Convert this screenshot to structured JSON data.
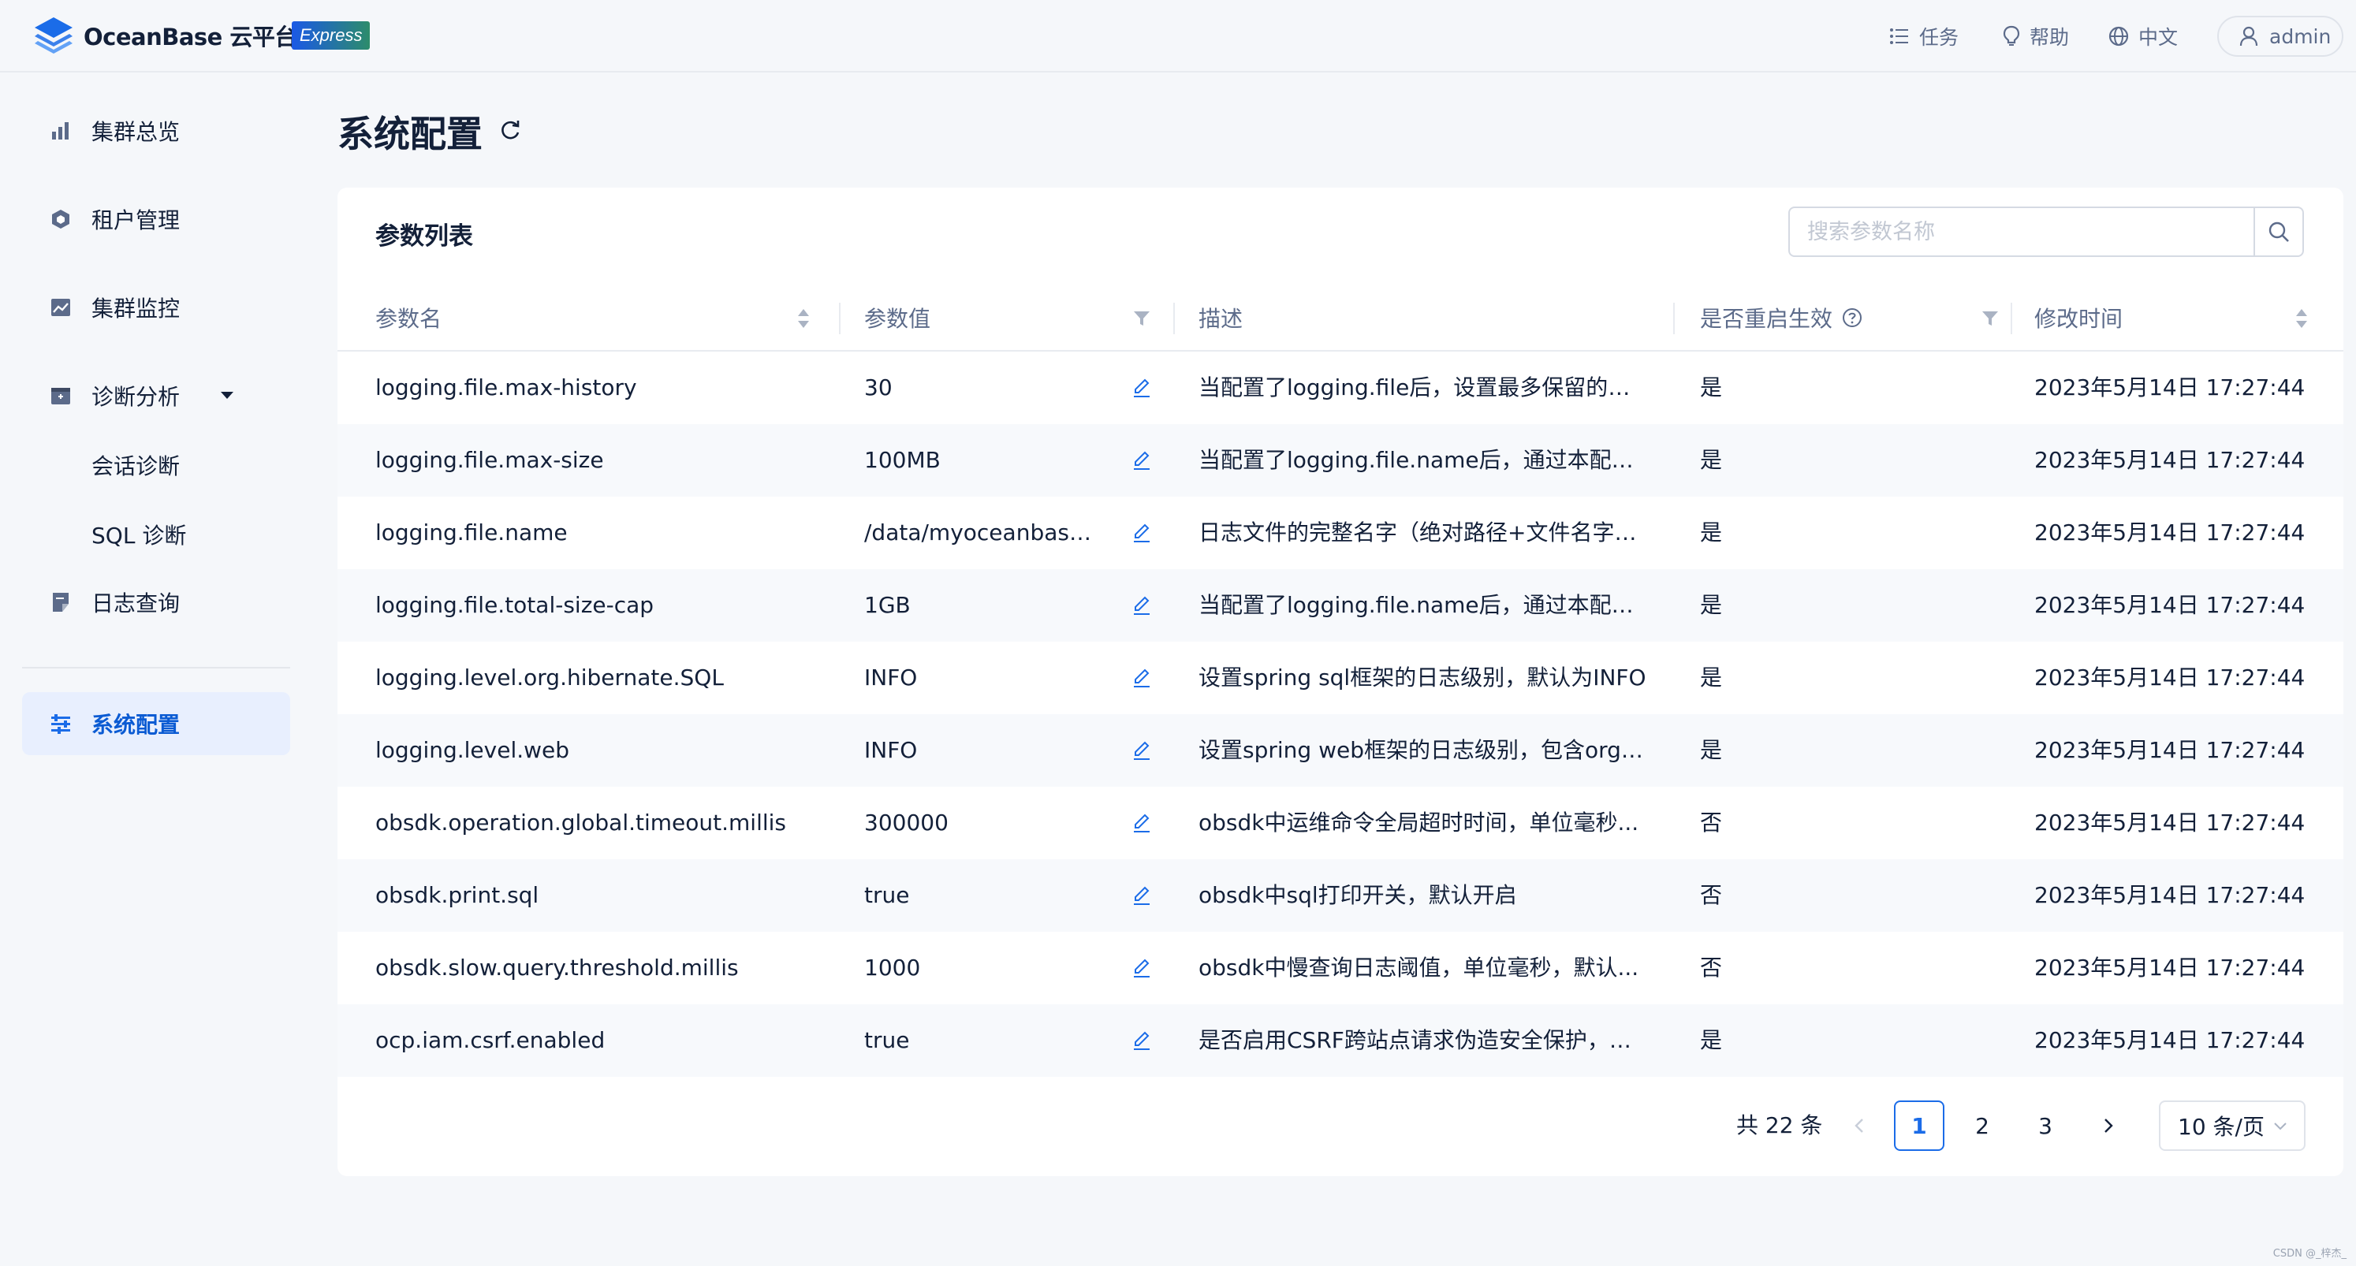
{
  "header": {
    "brand": "OceanBase 云平台",
    "badge": "Express",
    "nav_tasks": "任务",
    "nav_help": "帮助",
    "nav_lang": "中文",
    "user": "admin"
  },
  "sidebar": {
    "items": [
      {
        "label": "集群总览",
        "icon": "bar-chart-icon"
      },
      {
        "label": "租户管理",
        "icon": "tenant-hexagon-icon"
      },
      {
        "label": "集群监控",
        "icon": "monitor-chart-icon"
      },
      {
        "label": "诊断分析",
        "icon": "diagnosis-box-icon"
      },
      {
        "label": "日志查询",
        "icon": "log-file-icon"
      },
      {
        "label": "系统配置",
        "icon": "settings-sliders-icon"
      }
    ],
    "sub_items": [
      "会话诊断",
      "SQL 诊断"
    ]
  },
  "page": {
    "title": "系统配置"
  },
  "card": {
    "title": "参数列表",
    "search_placeholder": "搜索参数名称"
  },
  "table": {
    "columns": {
      "name": "参数名",
      "value": "参数值",
      "desc": "描述",
      "restart": "是否重启生效",
      "time": "修改时间"
    },
    "rows": [
      {
        "name": "logging.file.max-history",
        "value": "30",
        "desc": "当配置了logging.file后，设置最多保留的归...",
        "restart": "是",
        "time": "2023年5月14日 17:27:44"
      },
      {
        "name": "logging.file.max-size",
        "value": "100MB",
        "desc": "当配置了logging.file.name后，通过本配置...",
        "restart": "是",
        "time": "2023年5月14日 17:27:44"
      },
      {
        "name": "logging.file.name",
        "value": "/data/myoceanbase/oc...",
        "desc": "日志文件的完整名字（绝对路径+文件名字）...",
        "restart": "是",
        "time": "2023年5月14日 17:27:44"
      },
      {
        "name": "logging.file.total-size-cap",
        "value": "1GB",
        "desc": "当配置了logging.file.name后，通过本配置...",
        "restart": "是",
        "time": "2023年5月14日 17:27:44"
      },
      {
        "name": "logging.level.org.hibernate.SQL",
        "value": "INFO",
        "desc": "设置spring sql框架的日志级别，默认为INFO",
        "restart": "是",
        "time": "2023年5月14日 17:27:44"
      },
      {
        "name": "logging.level.web",
        "value": "INFO",
        "desc": "设置spring web框架的日志级别，包含org.s...",
        "restart": "是",
        "time": "2023年5月14日 17:27:44"
      },
      {
        "name": "obsdk.operation.global.timeout.millis",
        "value": "300000",
        "desc": "obsdk中运维命令全局超时时间，单位毫秒...",
        "restart": "否",
        "time": "2023年5月14日 17:27:44"
      },
      {
        "name": "obsdk.print.sql",
        "value": "true",
        "desc": "obsdk中sql打印开关，默认开启",
        "restart": "否",
        "time": "2023年5月14日 17:27:44"
      },
      {
        "name": "obsdk.slow.query.threshold.millis",
        "value": "1000",
        "desc": "obsdk中慢查询日志阈值，单位毫秒，默认...",
        "restart": "否",
        "time": "2023年5月14日 17:27:44"
      },
      {
        "name": "ocp.iam.csrf.enabled",
        "value": "true",
        "desc": "是否启用CSRF跨站点请求伪造安全保护，通...",
        "restart": "是",
        "time": "2023年5月14日 17:27:44"
      }
    ]
  },
  "pagination": {
    "total": "共 22 条",
    "pages": [
      "1",
      "2",
      "3"
    ],
    "current": "1",
    "page_size": "10 条/页"
  },
  "watermark": "CSDN @_梓杰_",
  "colors": {
    "accent": "#1b6ce8",
    "sidebar_active_bg": "#e8effe",
    "page_bg": "#f5f7fa"
  }
}
